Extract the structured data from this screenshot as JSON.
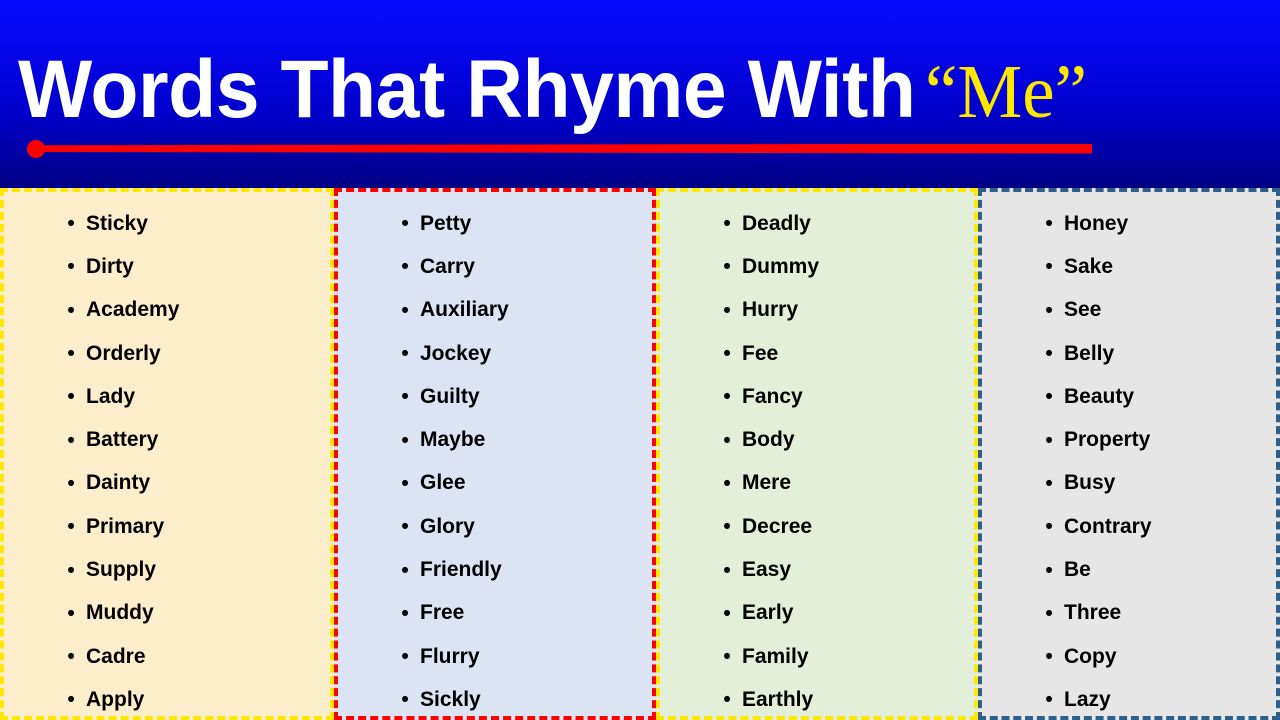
{
  "header": {
    "title_main": "Words That Rhyme With",
    "title_highlight": "“Me”",
    "background_color_top": "#0a0aff",
    "background_color_bottom": "#000084",
    "title_color": "#ffffff",
    "highlight_color": "#ffe800",
    "underline_color": "#fe0000"
  },
  "columns": [
    {
      "name": "column-1",
      "background_color": "#fdeecb",
      "border_color": "#ffe800",
      "border_style": "dashed",
      "words": [
        "Sticky",
        "Dirty",
        "Academy",
        "Orderly",
        "Lady",
        "Battery",
        "Dainty",
        "Primary",
        "Supply",
        "Muddy",
        "Cadre",
        "Apply"
      ]
    },
    {
      "name": "column-2",
      "background_color": "#dce3f2",
      "border_color": "#fe0000",
      "border_style": "dash-dot",
      "words": [
        "Petty",
        "Carry",
        "Auxiliary",
        "Jockey",
        "Guilty",
        "Maybe",
        "Glee",
        "Glory",
        "Friendly",
        "Free",
        "Flurry",
        "Sickly"
      ]
    },
    {
      "name": "column-3",
      "background_color": "#e3efd8",
      "border_color": "#ffe800",
      "border_style": "dashed",
      "words": [
        "Deadly",
        "Dummy",
        "Hurry",
        "Fee",
        "Fancy",
        "Body",
        "Mere",
        "Decree",
        "Easy",
        "Early",
        "Family",
        "Earthly"
      ]
    },
    {
      "name": "column-4",
      "background_color": "#e6e6e6",
      "border_color": "#2e5f8a",
      "border_style": "dashed",
      "words": [
        "Honey",
        "Sake",
        "See",
        "Belly",
        "Beauty",
        "Property",
        "Busy",
        "Contrary",
        "Be",
        "Three",
        "Copy",
        "Lazy"
      ]
    }
  ],
  "bullet_glyph": "•"
}
